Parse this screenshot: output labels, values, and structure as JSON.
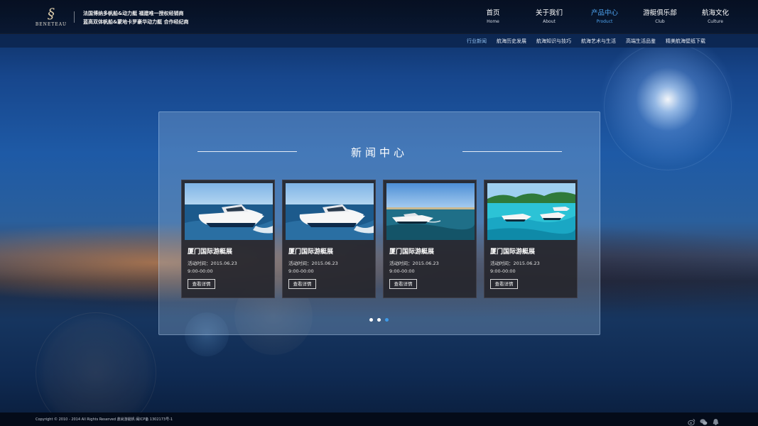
{
  "brand": {
    "logo_text": "BENETEAU",
    "tagline_line1": "法国博纳多帆船&动力艇  福建唯一授权经销商",
    "tagline_line2": "蓝高双体帆船&蒙地卡罗豪华动力艇  合作经纪商"
  },
  "nav": [
    {
      "cn": "首页",
      "en": "Home",
      "active": false
    },
    {
      "cn": "关于我们",
      "en": "About",
      "active": false
    },
    {
      "cn": "产品中心",
      "en": "Product",
      "active": true
    },
    {
      "cn": "游艇俱乐部",
      "en": "Club",
      "active": false
    },
    {
      "cn": "航海文化",
      "en": "Culture",
      "active": false
    }
  ],
  "subnav": [
    {
      "label": "行业新闻",
      "active": true
    },
    {
      "label": "航海历史发展",
      "active": false
    },
    {
      "label": "航海知识与技巧",
      "active": false
    },
    {
      "label": "航海艺术与生活",
      "active": false
    },
    {
      "label": "高端生活品鉴",
      "active": false
    },
    {
      "label": "精美航海壁纸下载",
      "active": false
    }
  ],
  "news": {
    "title": "新闻中心",
    "cards": [
      {
        "title": "厦门国际游艇展",
        "date": "活动时间：2015.06.23",
        "time": "9:00-00:00",
        "button": "查看详情",
        "image": "speedboat-wave"
      },
      {
        "title": "厦门国际游艇展",
        "date": "活动时间：2015.06.23",
        "time": "9:00-00:00",
        "button": "查看详情",
        "image": "speedboat-wave"
      },
      {
        "title": "厦门国际游艇展",
        "date": "活动时间：2015.06.23",
        "time": "9:00-00:00",
        "button": "查看详情",
        "image": "yacht-open-sea"
      },
      {
        "title": "厦门国际游艇展",
        "date": "活动时间：2015.06.23",
        "time": "9:00-00:00",
        "button": "查看详情",
        "image": "yachts-lagoon"
      }
    ],
    "pagination": {
      "pages": 3,
      "active_index": 2
    }
  },
  "footer": {
    "copyright": "Copyright © 2010 - 2014 All Rights Reserved 鼎尚游艇帆 闽ICP备 1302173号-1",
    "social_icons": [
      "weibo-icon",
      "wechat-icon",
      "qq-icon"
    ]
  },
  "colors": {
    "accent": "#4ea3f0",
    "header_bg": "#08142a",
    "card_bg": "#26262c",
    "pagination_active": "#3f9ae8"
  }
}
